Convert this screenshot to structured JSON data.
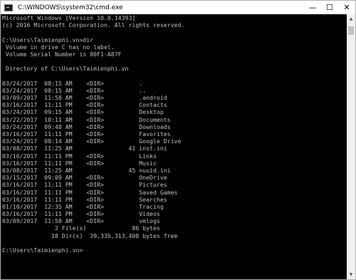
{
  "window": {
    "title": "C:\\WINDOWS\\system32\\cmd.exe",
    "controls": {
      "minimize": "—",
      "maximize": "☐",
      "close": "✕"
    }
  },
  "icons": {
    "app": "cmd-icon",
    "scroll_up": "arrow-up-icon",
    "scroll_down": "arrow-down-icon"
  },
  "colors": {
    "console_bg": "#000000",
    "console_text": "#c0c0c0",
    "titlebar_bg": "#ffffff"
  },
  "console": {
    "lines": [
      "Microsoft Windows [Version 10.0.14393]",
      "(c) 2016 Microsoft Corporation. All rights reserved.",
      "",
      "C:\\Users\\Taimienphi.vn>dir",
      " Volume in drive C has no label.",
      " Volume Serial Number is 80F1-A87F",
      "",
      " Directory of C:\\Users\\Taimienphi.vn",
      "",
      "03/24/2017  08:15 AM    <DIR>          .",
      "03/24/2017  08:15 AM    <DIR>          ..",
      "03/09/2017  11:58 AM    <DIR>          .android",
      "03/16/2017  11:11 PM    <DIR>          Contacts",
      "03/24/2017  09:15 AM    <DIR>          Desktop",
      "03/22/2017  10:11 AM    <DIR>          Documents",
      "03/24/2017  09:48 AM    <DIR>          Downloads",
      "03/16/2017  11:11 PM    <DIR>          Favorites",
      "03/24/2017  08:14 AM    <DIR>          Google Drive",
      "03/08/2017  11:25 AM                41 inst.ini",
      "03/16/2017  11:11 PM    <DIR>          Links",
      "03/16/2017  11:11 PM    <DIR>          Music",
      "03/08/2017  11:25 AM                45 nuuid.ini",
      "03/15/2017  09:09 AM    <DIR>          OneDrive",
      "03/16/2017  11:11 PM    <DIR>          Pictures",
      "03/16/2017  11:11 PM    <DIR>          Saved Games",
      "03/16/2017  11:11 PM    <DIR>          Searches",
      "01/10/2017  12:35 AM    <DIR>          Tracing",
      "03/16/2017  11:11 PM    <DIR>          Videos",
      "03/09/2017  11:58 AM    <DIR>          vmlogs",
      "               2 File(s)             86 bytes",
      "              18 Dir(s)  39,335,313,408 bytes free",
      "",
      "C:\\Users\\Taimienphi.vn>"
    ]
  }
}
